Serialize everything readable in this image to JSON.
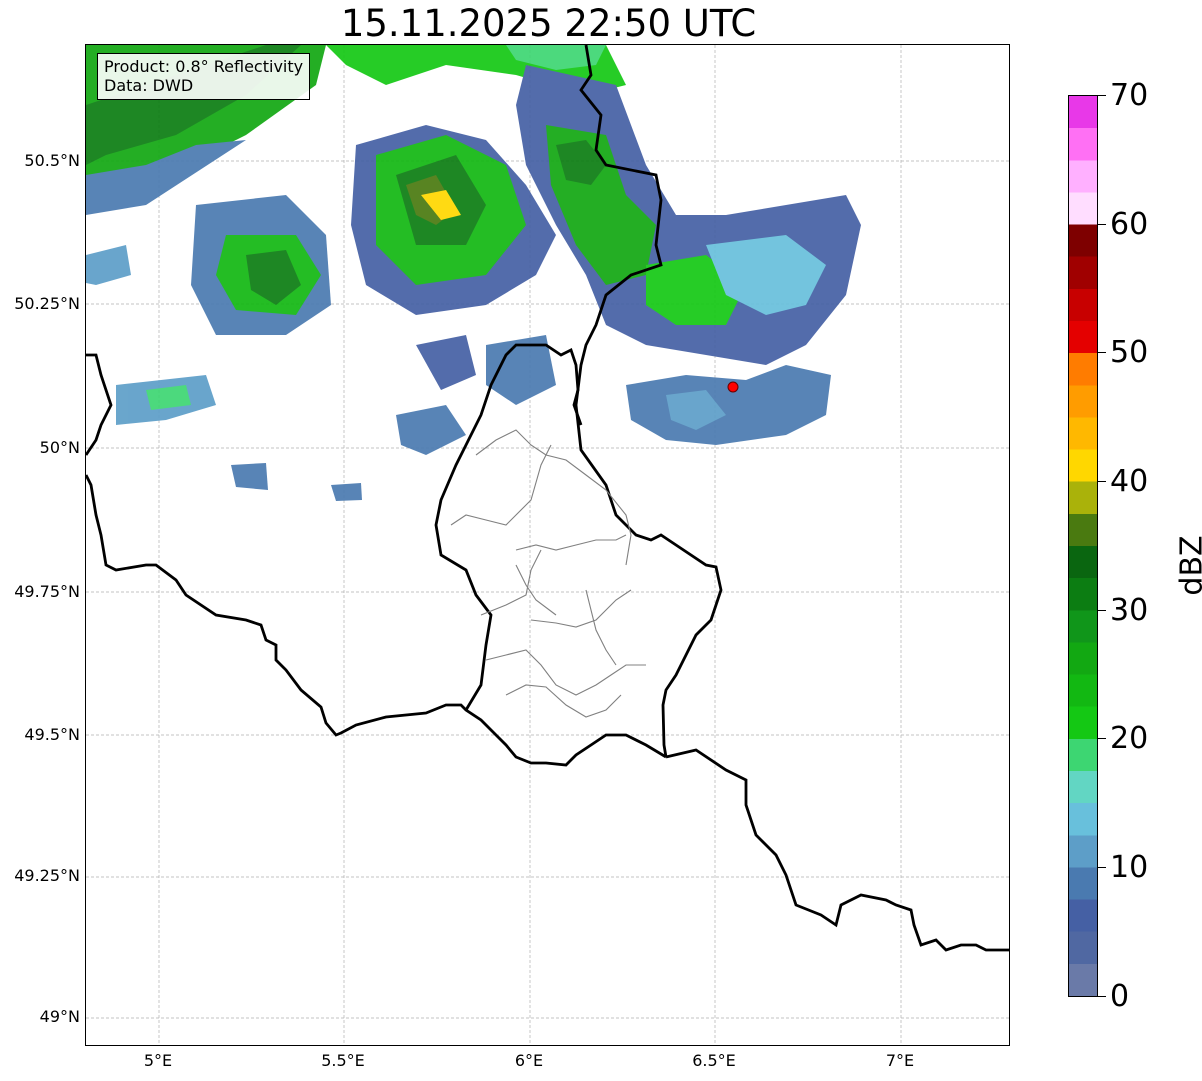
{
  "title": "15.11.2025 22:50 UTC",
  "info": {
    "product": "Product: 0.8° Reflectivity",
    "source": "Data: DWD"
  },
  "axes": {
    "lat_labels": [
      "50.5°N",
      "50.25°N",
      "50°N",
      "49.75°N",
      "49.5°N",
      "49.25°N",
      "49°N"
    ],
    "lon_labels": [
      "5°E",
      "5.5°E",
      "6°E",
      "6.5°E",
      "7°E"
    ]
  },
  "colorbar": {
    "label": "dBZ",
    "tick_labels": [
      "0",
      "10",
      "20",
      "30",
      "40",
      "50",
      "60",
      "70"
    ],
    "colors": [
      "#6a7aa8",
      "#5068a2",
      "#4560a4",
      "#4a7ab0",
      "#5d9ec8",
      "#68c0dc",
      "#62d6c3",
      "#3dd672",
      "#14c814",
      "#12b812",
      "#12a812",
      "#10961a",
      "#0c7d12",
      "#0a6610",
      "#4a7a10",
      "#aab20a",
      "#ffd700",
      "#ffb800",
      "#ff9c00",
      "#ff7c00",
      "#e40000",
      "#c80000",
      "#a00000",
      "#7e0000",
      "#ffddff",
      "#ffb0ff",
      "#ff70f4",
      "#e838e8"
    ]
  },
  "marker": {
    "label": "radar-site",
    "color": "#ff0000"
  }
}
